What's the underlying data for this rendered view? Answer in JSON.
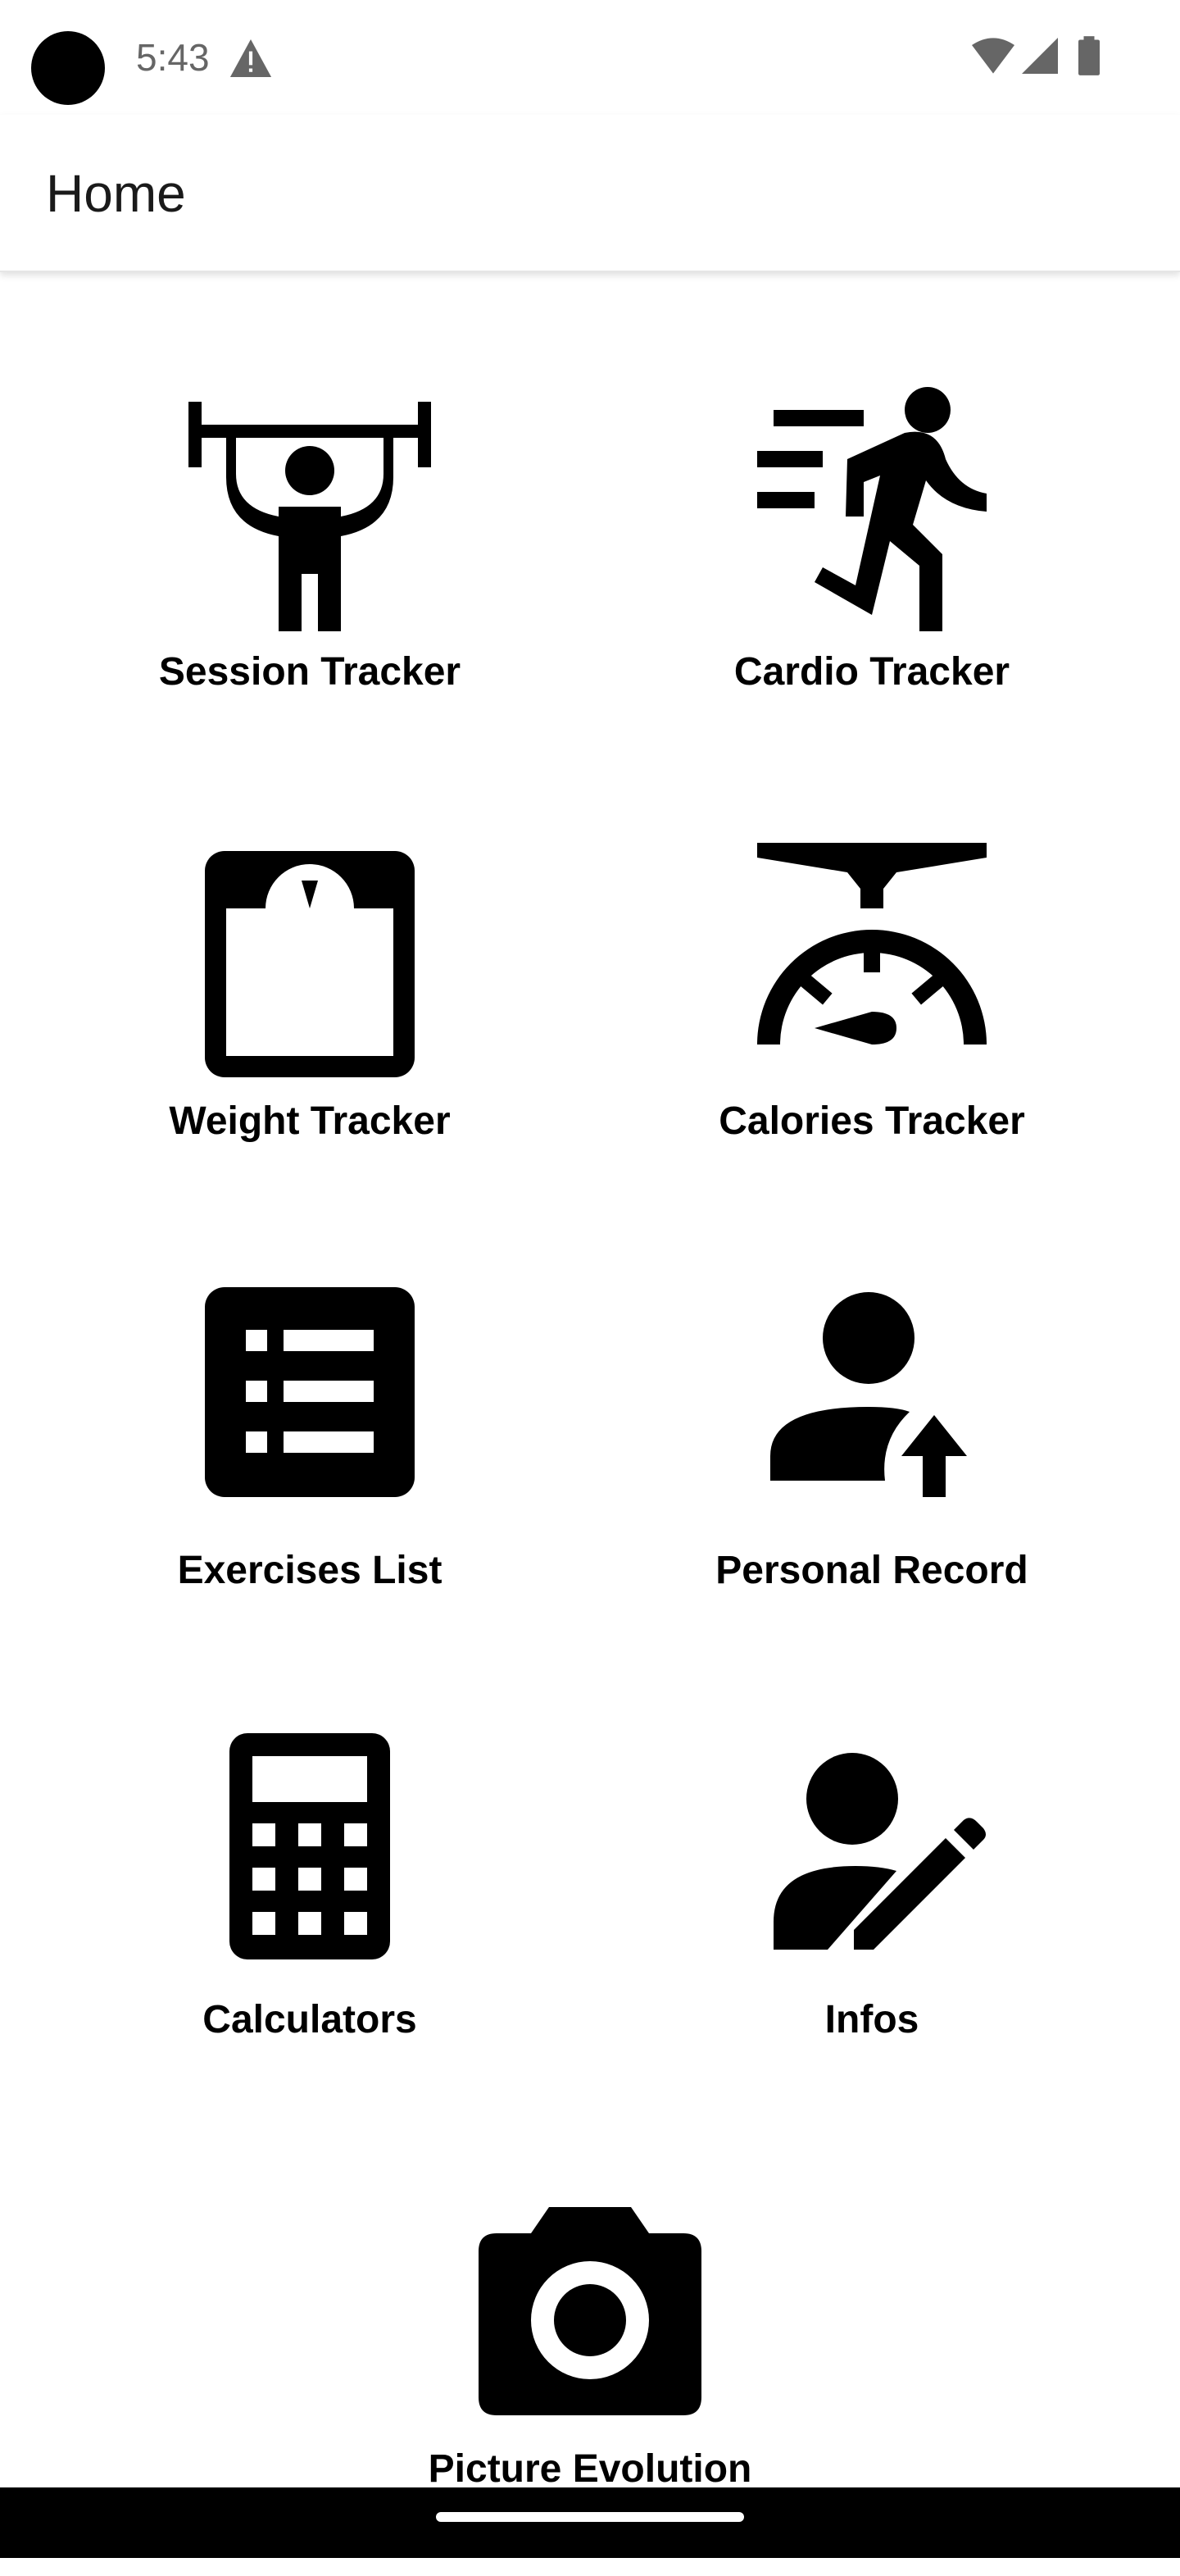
{
  "status_bar": {
    "time": "5:43",
    "icons": [
      "warning-icon",
      "wifi-icon",
      "signal-icon",
      "battery-icon"
    ]
  },
  "app_bar": {
    "title": "Home"
  },
  "tiles": [
    {
      "id": "session",
      "label": "Session Tracker",
      "icon": "weightlifter-icon"
    },
    {
      "id": "cardio",
      "label": "Cardio Tracker",
      "icon": "running-icon"
    },
    {
      "id": "weight",
      "label": "Weight Tracker",
      "icon": "scale-icon"
    },
    {
      "id": "calories",
      "label": "Calories Tracker",
      "icon": "food-scale-icon"
    },
    {
      "id": "exercises",
      "label": "Exercises List",
      "icon": "list-icon"
    },
    {
      "id": "record",
      "label": "Personal Record",
      "icon": "person-arrow-up-icon"
    },
    {
      "id": "calculators",
      "label": "Calculators",
      "icon": "calculator-icon"
    },
    {
      "id": "infos",
      "label": "Infos",
      "icon": "person-edit-icon"
    },
    {
      "id": "picture",
      "label": "Picture Evolution",
      "icon": "camera-icon"
    }
  ],
  "colors": {
    "background": "#ffffff",
    "icon": "#000000",
    "status_text": "#666666",
    "nav_bar": "#000000"
  }
}
